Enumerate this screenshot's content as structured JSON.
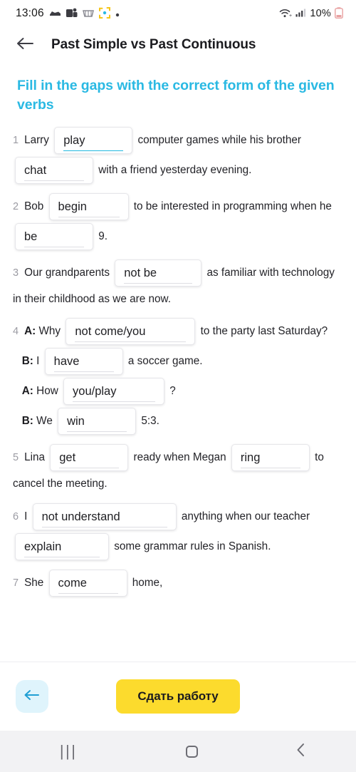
{
  "status_bar": {
    "time": "13:06",
    "left_icons": [
      "shoe-icon",
      "teams-icon",
      "basket-icon",
      "scan-frame-icon",
      "dot-icon"
    ],
    "wifi_icon": "wifi-icon",
    "signal_icon": "cellular-signal-icon",
    "battery_percent": "10%",
    "battery_icon": "battery-low-icon"
  },
  "header": {
    "back_icon": "arrow-left-icon",
    "title": "Past Simple vs Past Continuous"
  },
  "task": {
    "heading": "Fill in the gaps with the correct form of the given verbs"
  },
  "questions": [
    {
      "number": "1",
      "parts": [
        {
          "t": "text",
          "v": "Larry"
        },
        {
          "t": "gap",
          "v": "play",
          "active": true
        },
        {
          "t": "text",
          "v": "computer games while his brother"
        },
        {
          "t": "gap",
          "v": "chat",
          "active": false
        },
        {
          "t": "text",
          "v": "with a friend yesterday evening."
        }
      ]
    },
    {
      "number": "2",
      "parts": [
        {
          "t": "text",
          "v": "Bob"
        },
        {
          "t": "gap",
          "v": "begin",
          "active": false
        },
        {
          "t": "text",
          "v": "to be interested in programming when he"
        },
        {
          "t": "gap",
          "v": "be",
          "active": false
        },
        {
          "t": "text",
          "v": "9."
        }
      ]
    },
    {
      "number": "3",
      "parts": [
        {
          "t": "text",
          "v": "Our grandparents"
        },
        {
          "t": "gap",
          "v": "not be",
          "active": false
        },
        {
          "t": "text",
          "v": "as familiar with technology in their childhood as we are now."
        }
      ]
    },
    {
      "number": "4",
      "parts": [
        {
          "t": "bold",
          "v": "A:"
        },
        {
          "t": "text",
          "v": "Why"
        },
        {
          "t": "gap",
          "v": "not come/you",
          "active": false
        },
        {
          "t": "text",
          "v": "to the party last Saturday?"
        },
        {
          "t": "break"
        },
        {
          "t": "bold",
          "v": "B:"
        },
        {
          "t": "text",
          "v": "I"
        },
        {
          "t": "gap",
          "v": "have",
          "active": false
        },
        {
          "t": "text",
          "v": "a soccer game."
        },
        {
          "t": "break"
        },
        {
          "t": "bold",
          "v": "A:"
        },
        {
          "t": "text",
          "v": "How"
        },
        {
          "t": "gap",
          "v": "you/play",
          "active": false
        },
        {
          "t": "text",
          "v": "?"
        },
        {
          "t": "break"
        },
        {
          "t": "bold",
          "v": "B:"
        },
        {
          "t": "text",
          "v": "We"
        },
        {
          "t": "gap",
          "v": "win",
          "active": false
        },
        {
          "t": "text",
          "v": "5:3."
        }
      ]
    },
    {
      "number": "5",
      "parts": [
        {
          "t": "text",
          "v": "Lina"
        },
        {
          "t": "gap",
          "v": "get",
          "active": false
        },
        {
          "t": "text",
          "v": "ready when Megan"
        },
        {
          "t": "gap",
          "v": "ring",
          "active": false
        },
        {
          "t": "text",
          "v": "to cancel the meeting."
        }
      ]
    },
    {
      "number": "6",
      "parts": [
        {
          "t": "text",
          "v": "I"
        },
        {
          "t": "gap",
          "v": "not understand",
          "active": false
        },
        {
          "t": "text",
          "v": "anything when our teacher"
        },
        {
          "t": "gap",
          "v": "explain",
          "active": false
        },
        {
          "t": "text",
          "v": "some grammar rules in Spanish."
        }
      ]
    },
    {
      "number": "7",
      "parts": [
        {
          "t": "text",
          "v": "She"
        },
        {
          "t": "gap",
          "v": "come",
          "active": false
        },
        {
          "t": "text",
          "v": "home,"
        }
      ]
    }
  ],
  "bottom_bar": {
    "back_icon": "arrow-left-icon",
    "submit_label": "Сдать работу"
  },
  "android_nav": {
    "recents_label": "|||",
    "home_icon": "home-square-icon",
    "back_icon": "chevron-left-icon"
  },
  "colors": {
    "accent_cyan": "#2ab9e3",
    "submit_yellow": "#fcdb2d",
    "back_btn_bg": "#dff4fc",
    "text": "#222227"
  }
}
